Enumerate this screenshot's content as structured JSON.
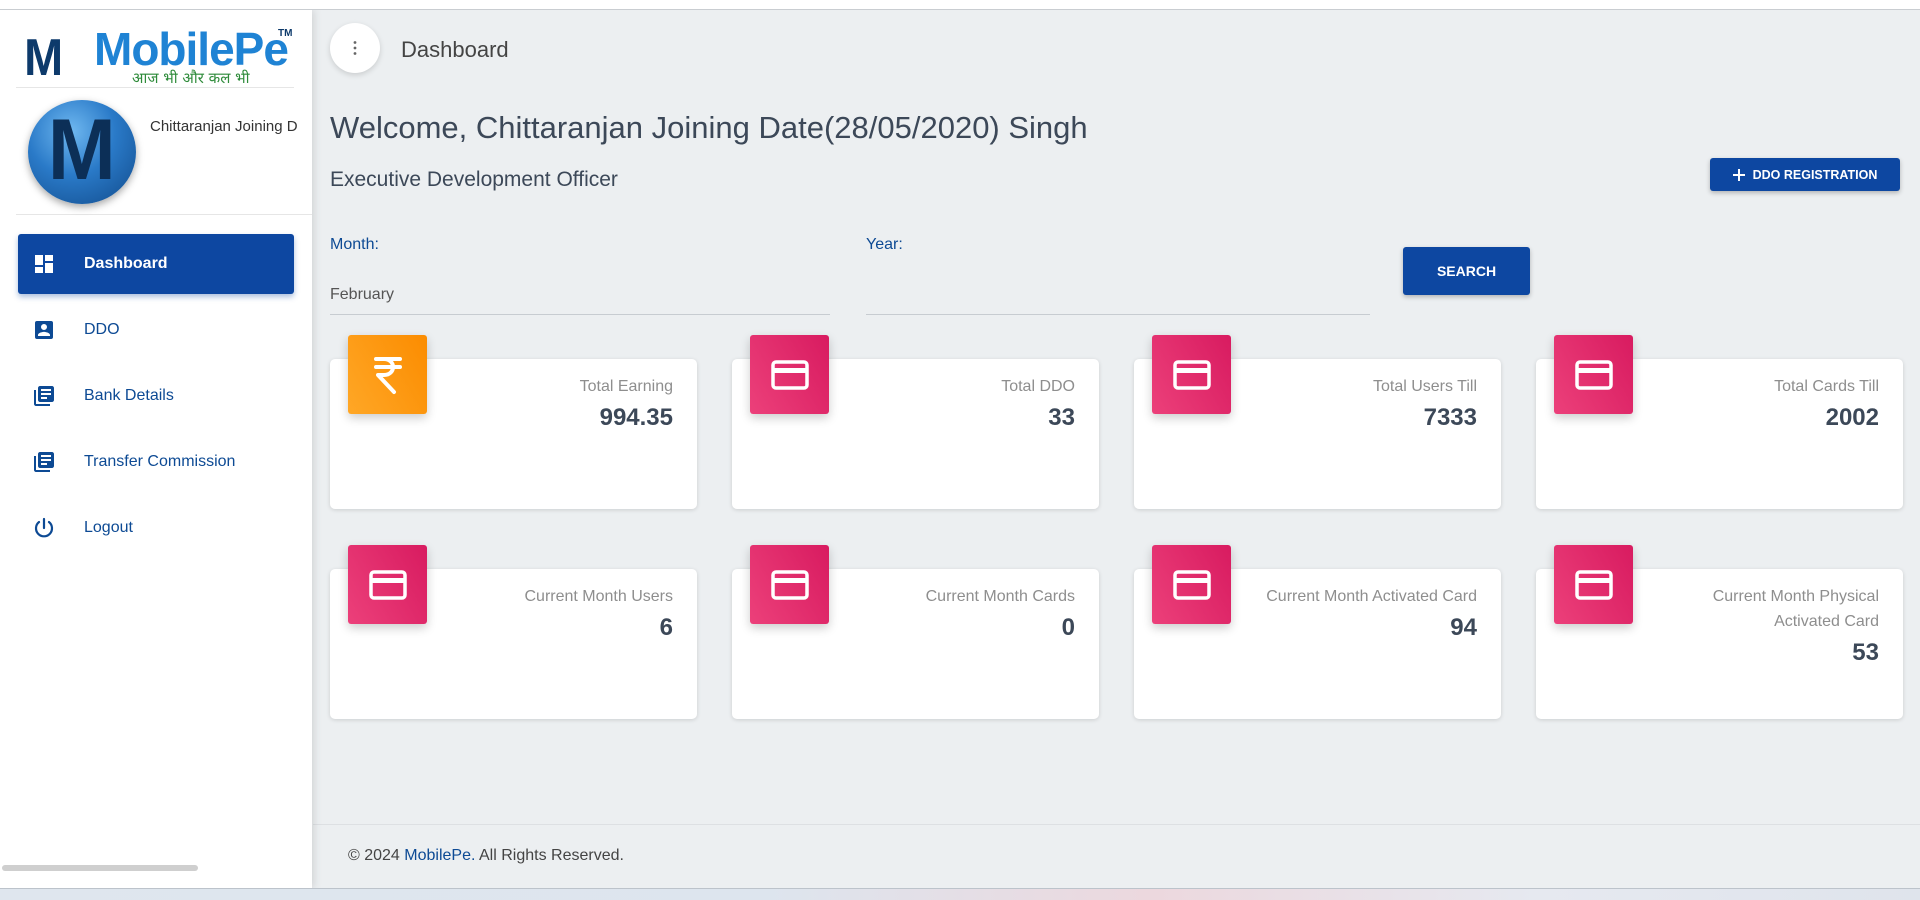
{
  "brand": {
    "logo_letter": "M",
    "name": "MobilePe",
    "trademark": "TM",
    "tagline": "आज भी और कल भी",
    "colors": {
      "primary": "#0d47a1",
      "pink": "#e91e63",
      "orange": "#fb8c00"
    }
  },
  "profile": {
    "avatar_letter": "M",
    "name": "Chittaranjan Joining D"
  },
  "sidebar": {
    "items": [
      {
        "label": "Dashboard",
        "icon": "dashboard-icon",
        "active": true
      },
      {
        "label": "DDO",
        "icon": "account-box-icon"
      },
      {
        "label": "Bank Details",
        "icon": "library-books-icon"
      },
      {
        "label": "Transfer Commission",
        "icon": "library-books-icon"
      },
      {
        "label": "Logout",
        "icon": "power-icon"
      }
    ]
  },
  "header": {
    "menu_icon": "more-vert-icon",
    "title": "Dashboard"
  },
  "welcome": {
    "title": "Welcome, Chittaranjan Joining Date(28/05/2020) Singh",
    "role": "Executive Development Officer"
  },
  "actions": {
    "ddo_registration": "DDO REGISTRATION",
    "search": "SEARCH"
  },
  "filters": {
    "month_label": "Month:",
    "month_value": "February",
    "year_label": "Year:",
    "year_value": ""
  },
  "cards": [
    {
      "label": "Total Earning",
      "value": "994.35",
      "icon": "rupee-icon",
      "color": "orange"
    },
    {
      "label": "Total DDO",
      "value": "33",
      "icon": "credit-card-icon",
      "color": "pink"
    },
    {
      "label": "Total Users Till",
      "value": "7333",
      "icon": "credit-card-icon",
      "color": "pink"
    },
    {
      "label": "Total Cards Till",
      "value": "2002",
      "icon": "credit-card-icon",
      "color": "pink"
    },
    {
      "label": "Current Month Users",
      "value": "6",
      "icon": "credit-card-icon",
      "color": "pink"
    },
    {
      "label": "Current Month Cards",
      "value": "0",
      "icon": "credit-card-icon",
      "color": "pink"
    },
    {
      "label": "Current Month Activated Card",
      "value": "94",
      "icon": "credit-card-icon",
      "color": "pink"
    },
    {
      "label_line1": "Current Month Physical",
      "label_line2": "Activated Card",
      "value": "53",
      "icon": "credit-card-icon",
      "color": "pink"
    }
  ],
  "footer": {
    "prefix": "© 2024 ",
    "link": "MobilePe.",
    "suffix": " All Rights Reserved."
  }
}
